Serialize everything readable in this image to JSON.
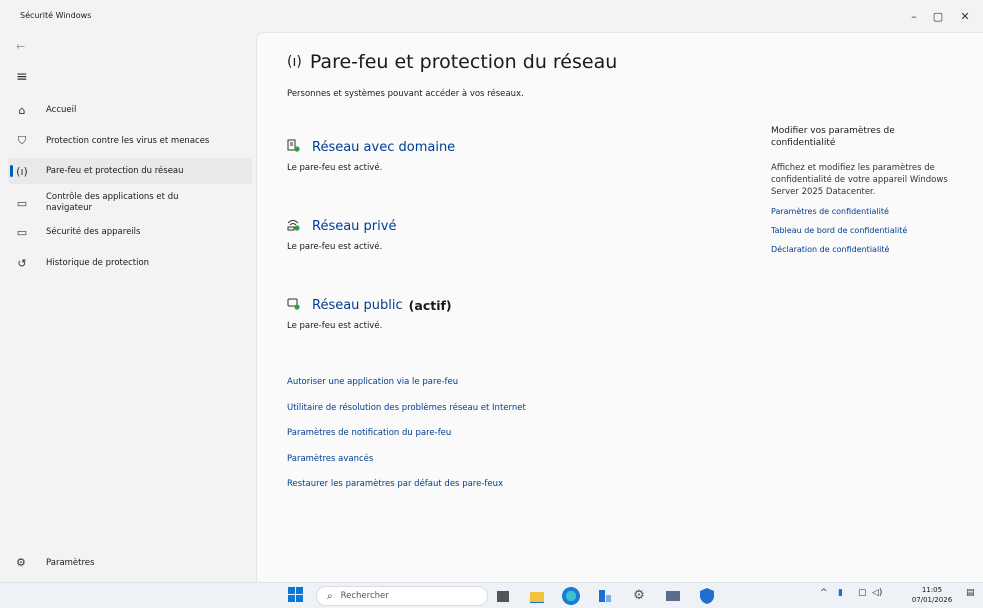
{
  "window": {
    "title": "Sécurité Windows",
    "controls": [
      "–",
      "▢",
      "✕"
    ]
  },
  "sidebar": {
    "back_icon": "←",
    "menu_icon": "≡",
    "items": [
      {
        "label": "Accueil",
        "icon": "home-icon",
        "glyph": "⌂"
      },
      {
        "label": "Protection contre les virus et menaces",
        "icon": "shield-icon",
        "glyph": "⛉"
      },
      {
        "label": "Pare-feu et protection du réseau",
        "icon": "antenna-icon",
        "glyph": "(ı)"
      },
      {
        "label": "Contrôle des applications et du navigateur",
        "icon": "app-window-icon",
        "glyph": "▭"
      },
      {
        "label": "Sécurité des appareils",
        "icon": "laptop-icon",
        "glyph": "▭"
      },
      {
        "label": "Historique de protection",
        "icon": "history-icon",
        "glyph": "↺"
      }
    ],
    "selected_index": 2,
    "settings_label": "Paramètres"
  },
  "main": {
    "title": "Pare-feu et protection du réseau",
    "subtitle": "Personnes et systèmes pouvant accéder à vos réseaux.",
    "networks": [
      {
        "name": "Réseau avec domaine",
        "status": "Le pare-feu est activé.",
        "active_label": "",
        "icon": "domain-network-icon"
      },
      {
        "name": "Réseau privé",
        "status": "Le pare-feu est activé.",
        "active_label": "",
        "icon": "private-network-icon"
      },
      {
        "name": "Réseau public",
        "status": "Le pare-feu est activé.",
        "active_label": "(actif)",
        "icon": "public-network-icon"
      }
    ],
    "links": [
      "Autoriser une application via le pare-feu",
      "Utilitaire de résolution des problèmes réseau et Internet",
      "Paramètres de notification du pare-feu",
      "Paramètres avancés",
      "Restaurer les paramètres par défaut des pare-feux"
    ]
  },
  "right_panel": {
    "title": "Modifier vos paramètres de confidentialité",
    "description": "Affichez et modifiez les paramètres de confidentialité de votre appareil Windows Server 2025 Datacenter.",
    "links": [
      "Paramètres de confidentialité",
      "Tableau de bord de confidentialité",
      "Déclaration de confidentialité"
    ]
  },
  "taskbar": {
    "search_placeholder": "Rechercher",
    "time": "11:05",
    "date": "07/01/2026",
    "colors": {
      "accent": "#0a78d4",
      "link": "#003e92",
      "selected_bar": "#005fb8"
    }
  }
}
